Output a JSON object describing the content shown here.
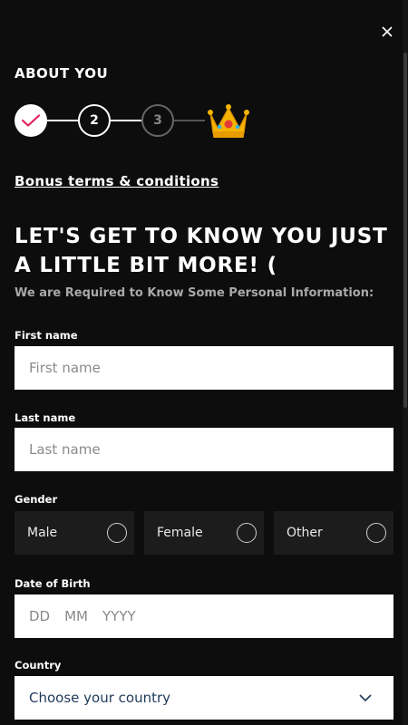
{
  "colors": {
    "background": "#0d0d0d",
    "accent_check": "#e0245e",
    "input_bg": "#ffffff",
    "option_bg": "#1c1c1c"
  },
  "header": {
    "close_icon": "close-icon",
    "section_title": "ABOUT YOU"
  },
  "steps": [
    {
      "state": "completed",
      "icon": "check-icon"
    },
    {
      "state": "active",
      "label": "2"
    },
    {
      "state": "pending",
      "label": "3"
    },
    {
      "state": "reward",
      "icon": "crown-icon"
    }
  ],
  "terms_link": "Bonus terms & conditions",
  "heading": "LET'S GET TO KNOW YOU JUST A LITTLE BIT MORE! (",
  "subheading": "We are Required to Know Some Personal Information:",
  "form": {
    "first_name": {
      "label": "First name",
      "placeholder": "First name",
      "value": ""
    },
    "last_name": {
      "label": "Last name",
      "placeholder": "Last name",
      "value": ""
    },
    "gender": {
      "label": "Gender",
      "options": [
        "Male",
        "Female",
        "Other"
      ],
      "selected": null
    },
    "dob": {
      "label": "Date of Birth",
      "day": "DD",
      "month": "MM",
      "year": "YYYY"
    },
    "country": {
      "label": "Country",
      "value": "Choose your country",
      "icon": "chevron-down-icon"
    }
  }
}
